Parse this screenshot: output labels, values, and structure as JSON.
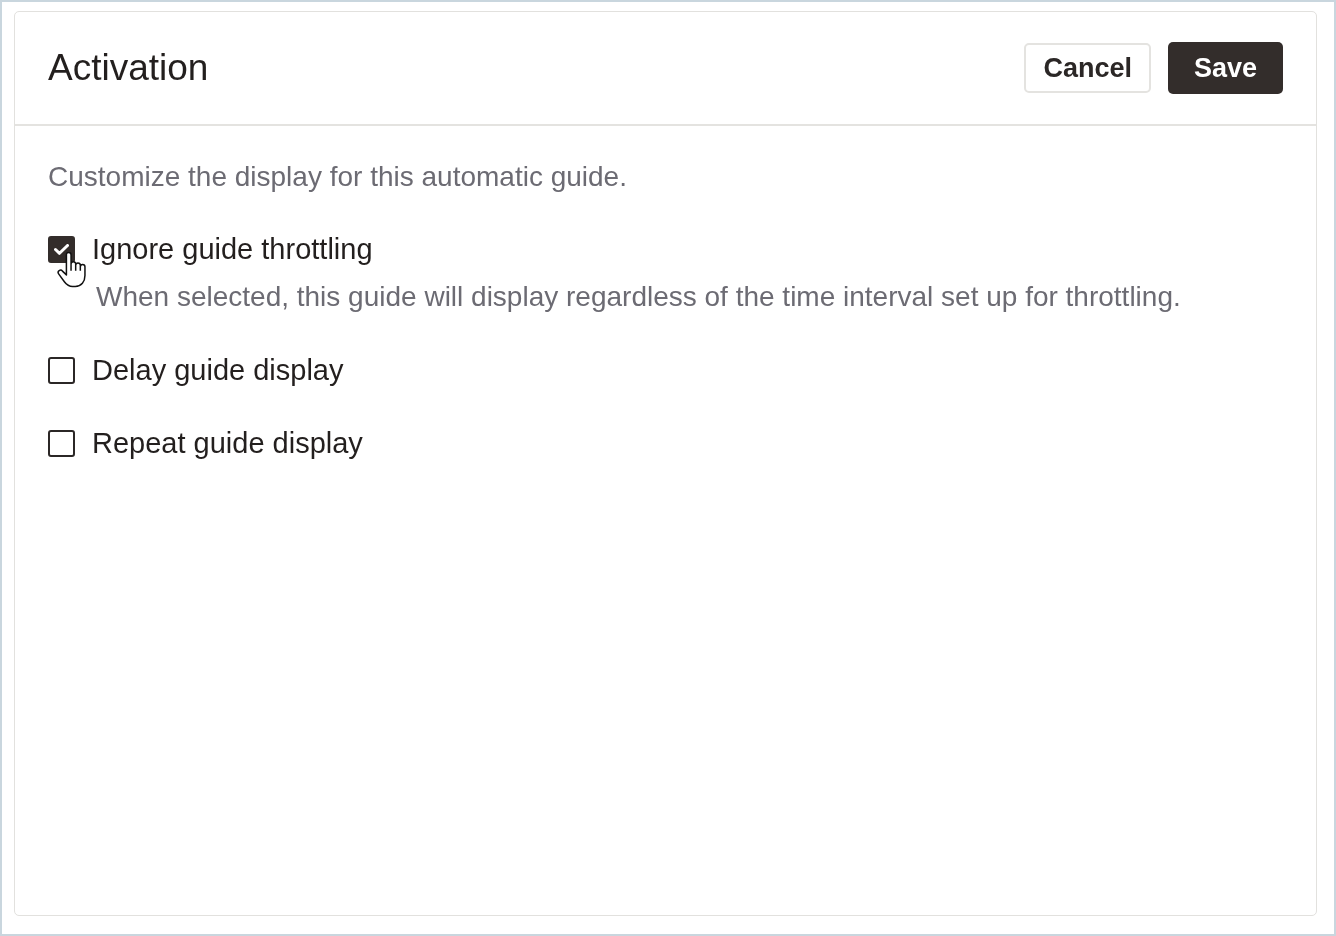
{
  "panel": {
    "title": "Activation",
    "buttons": [
      {
        "label": "Cancel",
        "kind": "secondary"
      },
      {
        "label": "Save",
        "kind": "primary"
      }
    ],
    "description": "Customize the display for this automatic guide.",
    "options": [
      {
        "label": "Ignore guide throttling",
        "checked": true,
        "help": "When selected, this guide will display regardless of the time interval set up for throttling."
      },
      {
        "label": "Delay guide display",
        "checked": false
      },
      {
        "label": "Repeat guide display",
        "checked": false
      }
    ]
  }
}
